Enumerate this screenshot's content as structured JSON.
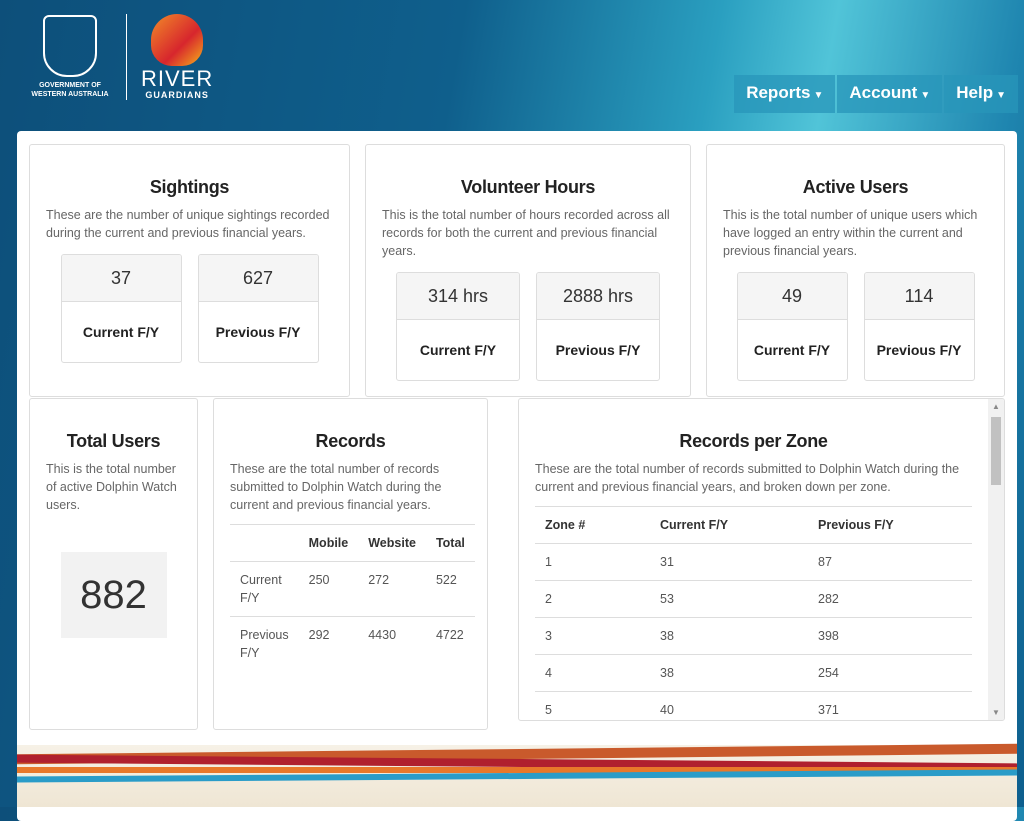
{
  "header": {
    "gov_text_1": "GOVERNMENT OF",
    "gov_text_2": "WESTERN AUSTRALIA",
    "brand_1": "RIVER",
    "brand_2": "GUARDIANS",
    "nav": [
      {
        "label": "Reports"
      },
      {
        "label": "Account"
      },
      {
        "label": "Help"
      }
    ]
  },
  "sightings": {
    "title": "Sightings",
    "desc": "These are the number of unique sightings recorded during the current and previous financial years.",
    "current": "37",
    "previous": "627",
    "current_label": "Current F/Y",
    "previous_label": "Previous F/Y"
  },
  "volunteer": {
    "title": "Volunteer Hours",
    "desc": "This is the total number of hours recorded across all records for both the current and previous financial years.",
    "current": "314 hrs",
    "previous": "2888 hrs",
    "current_label": "Current F/Y",
    "previous_label": "Previous F/Y"
  },
  "active": {
    "title": "Active Users",
    "desc": "This is the total number of unique users which have logged an entry within the current and previous financial years.",
    "current": "49",
    "previous": "114",
    "current_label": "Current F/Y",
    "previous_label": "Previous F/Y"
  },
  "total": {
    "title": "Total Users",
    "desc": "This is the total number of active Dolphin Watch users.",
    "value": "882"
  },
  "records": {
    "title": "Records",
    "desc": "These are the total number of records submitted to Dolphin Watch during the current and previous financial years.",
    "headers": [
      "",
      "Mobile",
      "Website",
      "Total"
    ],
    "rows": [
      [
        "Current F/Y",
        "250",
        "272",
        "522"
      ],
      [
        "Previous F/Y",
        "292",
        "4430",
        "4722"
      ]
    ]
  },
  "zones": {
    "title": "Records per Zone",
    "desc": "These are the total number of records submitted to Dolphin Watch during the current and previous financial years, and broken down per zone.",
    "headers": [
      "Zone #",
      "Current F/Y",
      "Previous F/Y"
    ],
    "rows": [
      [
        "1",
        "31",
        "87"
      ],
      [
        "2",
        "53",
        "282"
      ],
      [
        "3",
        "38",
        "398"
      ],
      [
        "4",
        "38",
        "254"
      ],
      [
        "5",
        "40",
        "371"
      ]
    ]
  },
  "colors": {
    "accent": "#2896b9",
    "wave_red": "#b0202e",
    "wave_orange": "#e8782a",
    "wave_blue": "#2a9cc8"
  }
}
